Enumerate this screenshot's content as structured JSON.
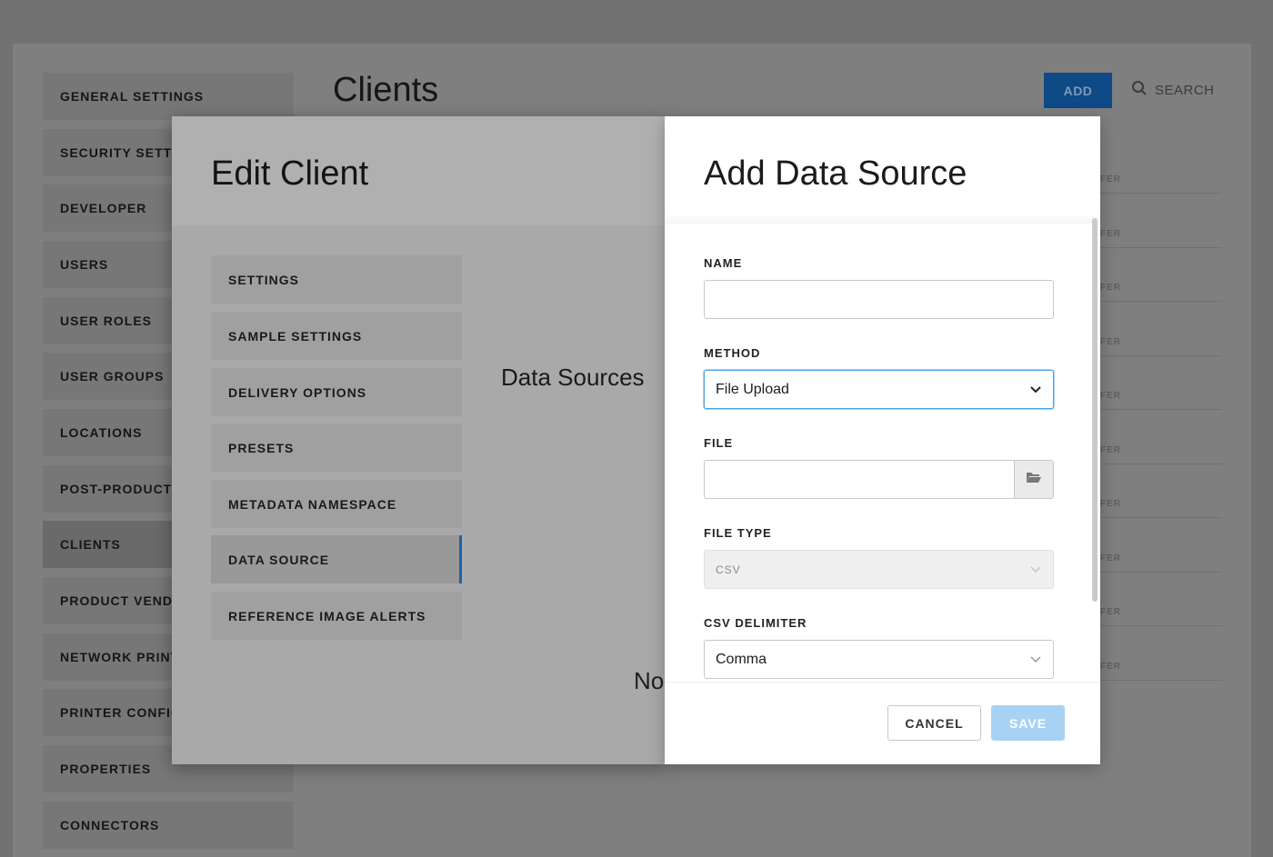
{
  "sidebar": {
    "items": [
      {
        "label": "GENERAL SETTINGS"
      },
      {
        "label": "SECURITY SETTINGS"
      },
      {
        "label": "DEVELOPER"
      },
      {
        "label": "USERS"
      },
      {
        "label": "USER ROLES"
      },
      {
        "label": "USER GROUPS"
      },
      {
        "label": "LOCATIONS"
      },
      {
        "label": "POST-PRODUCTION"
      },
      {
        "label": "CLIENTS"
      },
      {
        "label": "PRODUCT VENDORS"
      },
      {
        "label": "NETWORK PRINTERS"
      },
      {
        "label": "PRINTER CONFIG"
      },
      {
        "label": "PROPERTIES"
      },
      {
        "label": "CONNECTORS"
      }
    ],
    "active": "CLIENTS"
  },
  "page": {
    "title": "Clients",
    "add_label": "ADD",
    "search_label": "SEARCH",
    "row_tag": "FER"
  },
  "edit_client": {
    "title": "Edit Client",
    "tabs": [
      {
        "label": "SETTINGS"
      },
      {
        "label": "SAMPLE SETTINGS"
      },
      {
        "label": "DELIVERY OPTIONS"
      },
      {
        "label": "PRESETS"
      },
      {
        "label": "METADATA NAMESPACE"
      },
      {
        "label": "DATA SOURCE"
      },
      {
        "label": "REFERENCE IMAGE ALERTS"
      }
    ],
    "active_tab": "DATA SOURCE",
    "section_heading": "Data Sources",
    "empty_text": "No"
  },
  "add_data_source": {
    "title": "Add Data Source",
    "name": {
      "label": "NAME",
      "value": ""
    },
    "method": {
      "label": "METHOD",
      "value": "File Upload"
    },
    "file": {
      "label": "FILE",
      "value": ""
    },
    "file_type": {
      "label": "FILE TYPE",
      "value": "CSV"
    },
    "csv_delimiter": {
      "label": "CSV DELIMITER",
      "value": "Comma"
    },
    "cancel_label": "CANCEL",
    "save_label": "SAVE"
  },
  "colors": {
    "accent": "#1a73c7",
    "save_disabled": "#a7d2f4",
    "focus_border": "#4da3e6"
  }
}
